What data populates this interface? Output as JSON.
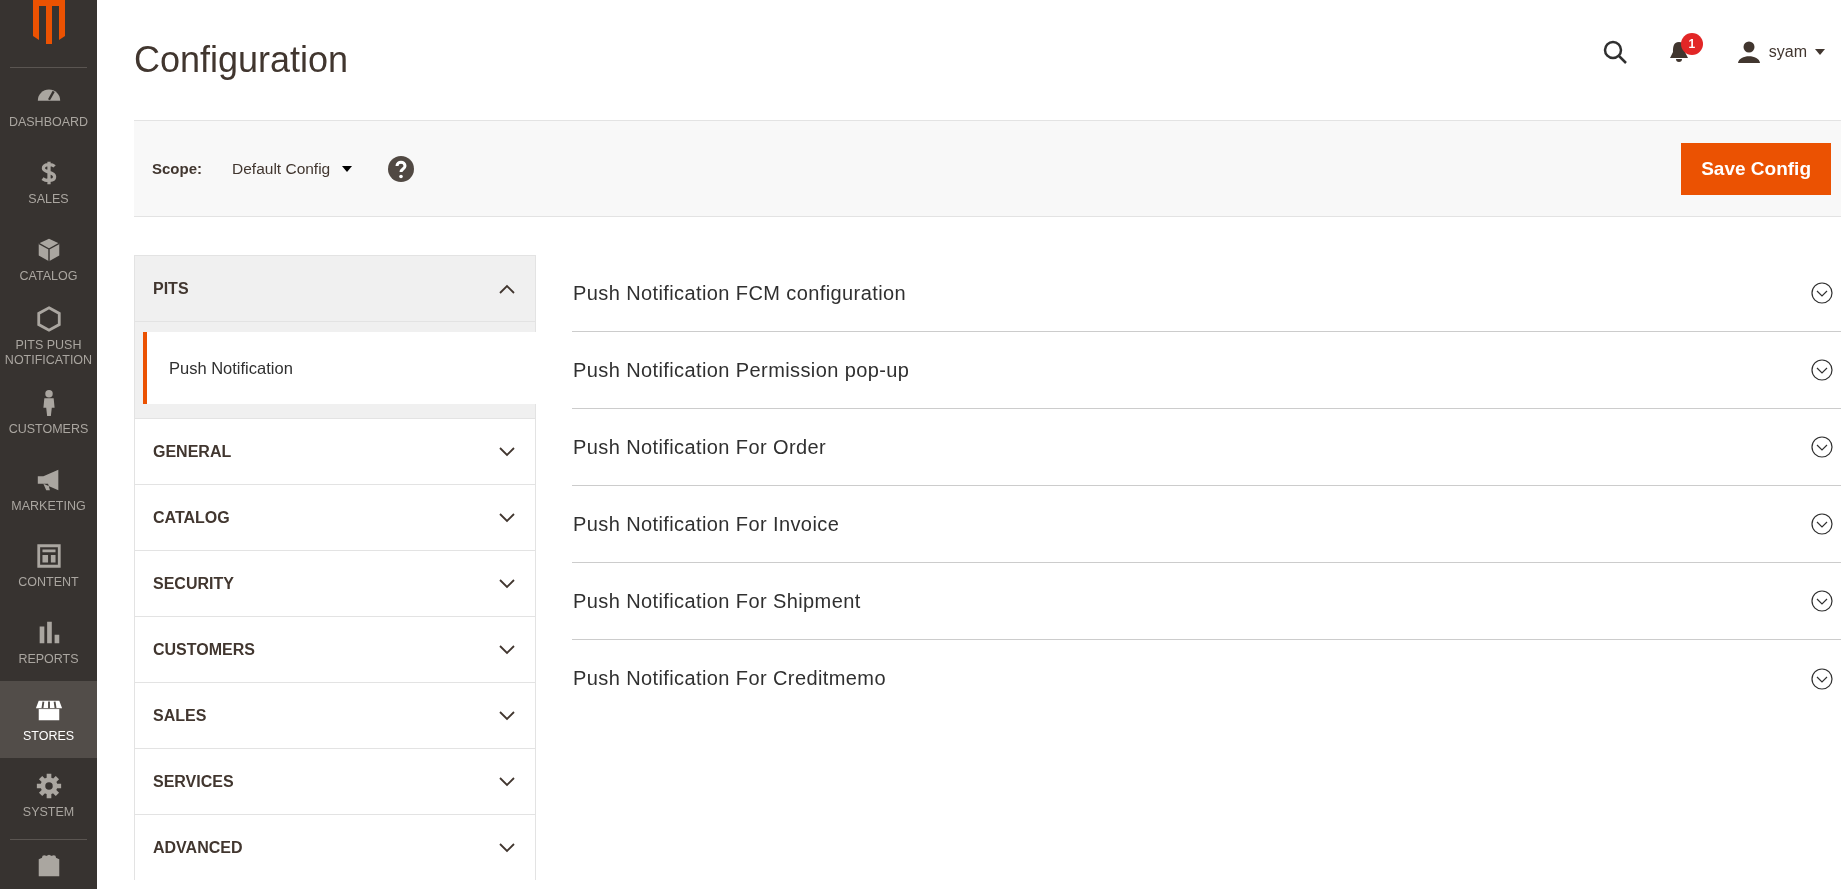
{
  "nav": [
    {
      "label": "DASHBOARD",
      "selected": false
    },
    {
      "label": "SALES",
      "selected": false
    },
    {
      "label": "CATALOG",
      "selected": false
    },
    {
      "label": "PITS PUSH NOTIFICATION",
      "selected": false
    },
    {
      "label": "CUSTOMERS",
      "selected": false
    },
    {
      "label": "MARKETING",
      "selected": false
    },
    {
      "label": "CONTENT",
      "selected": false
    },
    {
      "label": "REPORTS",
      "selected": false
    },
    {
      "label": "STORES",
      "selected": true
    },
    {
      "label": "SYSTEM",
      "selected": false
    }
  ],
  "page_title": "Configuration",
  "header": {
    "notification_count": "1",
    "user": "syam"
  },
  "scope": {
    "label": "Scope:",
    "value": "Default Config"
  },
  "save_button": "Save Config",
  "config_groups": [
    {
      "title": "PITS",
      "expanded": true,
      "children": [
        {
          "label": "Push Notification",
          "selected": true
        }
      ]
    },
    {
      "title": "GENERAL",
      "expanded": false
    },
    {
      "title": "CATALOG",
      "expanded": false
    },
    {
      "title": "SECURITY",
      "expanded": false
    },
    {
      "title": "CUSTOMERS",
      "expanded": false
    },
    {
      "title": "SALES",
      "expanded": false
    },
    {
      "title": "SERVICES",
      "expanded": false
    },
    {
      "title": "ADVANCED",
      "expanded": false
    }
  ],
  "sections": [
    {
      "title": "Push Notification FCM configuration",
      "expanded": false
    },
    {
      "title": "Push Notification Permission pop-up",
      "expanded": false
    },
    {
      "title": "Push Notification For Order",
      "expanded": false
    },
    {
      "title": "Push Notification For Invoice",
      "expanded": false
    },
    {
      "title": "Push Notification For Shipment",
      "expanded": false
    },
    {
      "title": "Push Notification For Creditmemo",
      "expanded": false
    }
  ]
}
